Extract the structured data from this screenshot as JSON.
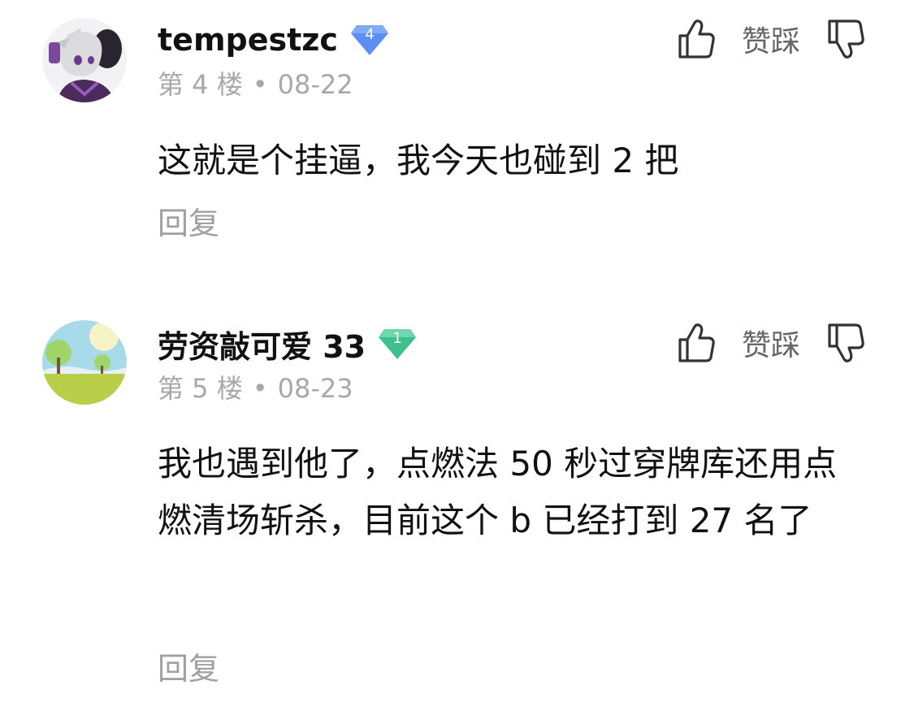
{
  "colors": {
    "badge_level4": "#5b8ff3",
    "badge_level1": "#3fbf8f",
    "meta_text": "#a8a8a8",
    "reply_text": "#a0a0a0",
    "main_text": "#111111"
  },
  "comments": [
    {
      "username": "tempestzc",
      "level": "4",
      "floor": "第 4 楼",
      "separator": "•",
      "date": "08-22",
      "text": "这就是个挂逼，我今天也碰到 2 把",
      "like_icon": "thumbs-up-icon",
      "dislike_label": "赞踩",
      "dislike_icon": "thumbs-down-icon",
      "reply_label": "回复"
    },
    {
      "username": "劳资敲可爱 33",
      "level": "1",
      "floor": "第 5 楼",
      "separator": "•",
      "date": "08-23",
      "text": "我也遇到他了，点燃法 50 秒过穿牌库还用点燃清场斩杀，目前这个 b 已经打到 27 名了",
      "like_icon": "thumbs-up-icon",
      "dislike_label": "赞踩",
      "dislike_icon": "thumbs-down-icon",
      "reply_label": "回复"
    }
  ]
}
